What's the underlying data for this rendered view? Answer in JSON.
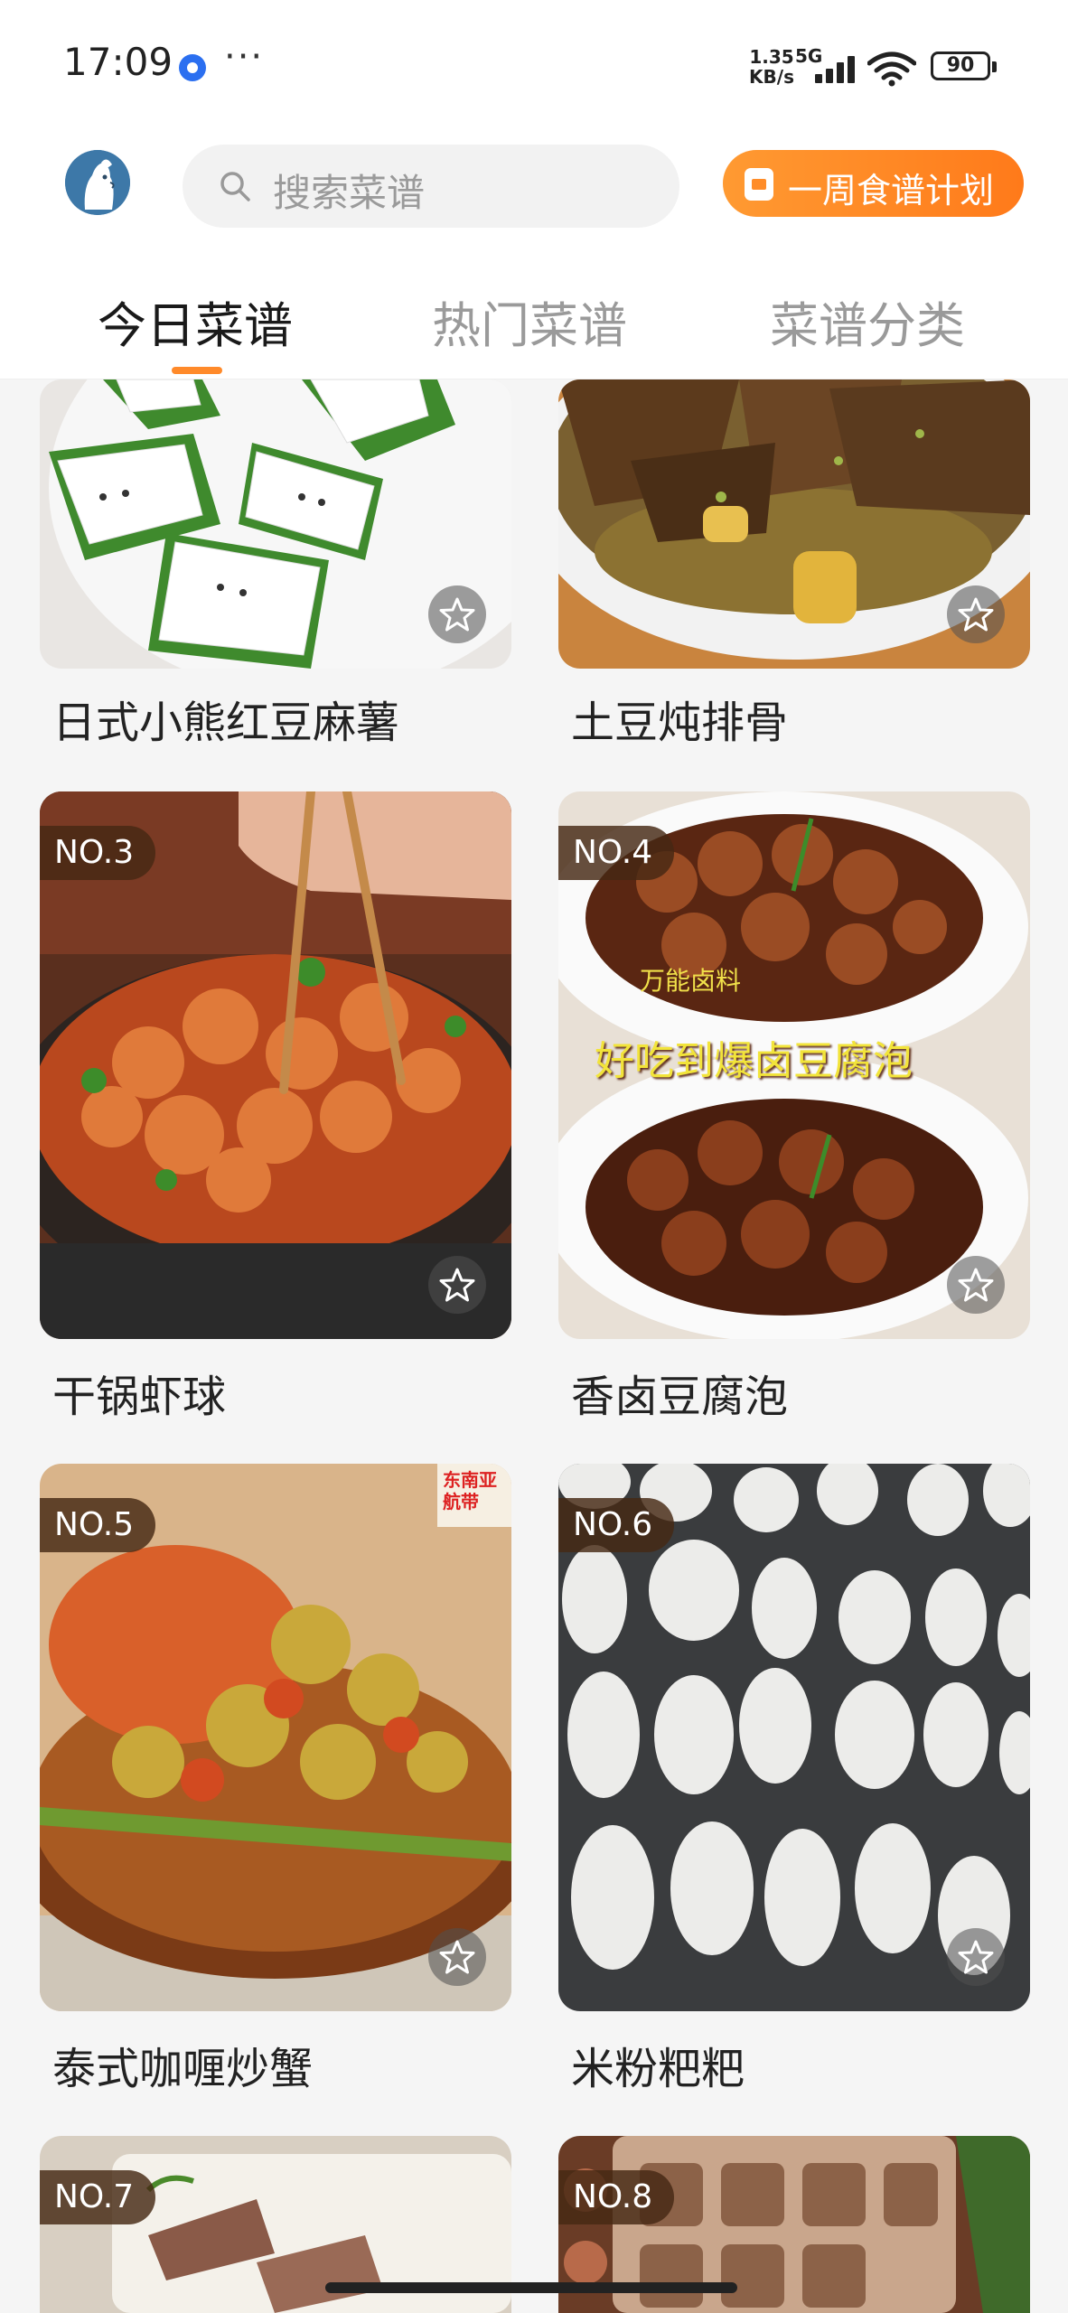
{
  "status_bar": {
    "time": "17:09",
    "more": "···",
    "net_speed_value": "1.35",
    "net_speed_unit": "KB/s",
    "network": "5G",
    "battery": "90"
  },
  "header": {
    "search_placeholder": "搜索菜谱",
    "plan_button": "一周食谱计划"
  },
  "tabs": [
    {
      "label": "今日菜谱",
      "active": true
    },
    {
      "label": "热门菜谱",
      "active": false
    },
    {
      "label": "菜谱分类",
      "active": false
    }
  ],
  "recipes": [
    {
      "rank": "",
      "title": "日式小熊红豆麻薯"
    },
    {
      "rank": "",
      "title": "土豆炖排骨"
    },
    {
      "rank": "NO.3",
      "title": "干锅虾球"
    },
    {
      "rank": "NO.4",
      "title": "香卤豆腐泡",
      "image_text_1": "万能卤料",
      "image_text_2": "好吃到爆卤豆腐泡"
    },
    {
      "rank": "NO.5",
      "title": "泰式咖喱炒蟹",
      "image_text_1": "东南亚航带"
    },
    {
      "rank": "NO.6",
      "title": "米粉粑粑"
    },
    {
      "rank": "NO.7",
      "title": ""
    },
    {
      "rank": "NO.8",
      "title": ""
    }
  ],
  "colors": {
    "accent_orange": "#ff8a2a",
    "badge_bg": "#46281488",
    "tab_active": "#1a1a1a",
    "tab_inactive": "#9a9a9a"
  }
}
